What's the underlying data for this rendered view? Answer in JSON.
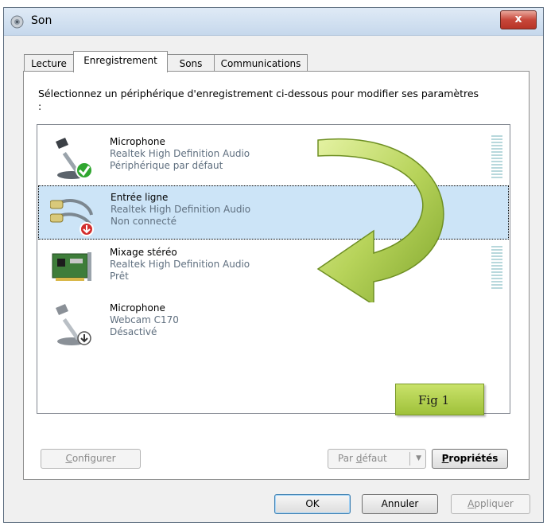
{
  "window": {
    "title": "Son",
    "close_label": "x"
  },
  "tabs": [
    {
      "label": "Lecture",
      "active": false
    },
    {
      "label": "Enregistrement",
      "active": true
    },
    {
      "label": "Sons",
      "active": false
    },
    {
      "label": "Communications",
      "active": false
    }
  ],
  "instructions": "Sélectionnez un périphérique d'enregistrement ci-dessous pour modifier ses paramètres :",
  "devices": [
    {
      "name": "Microphone",
      "driver": "Realtek High Definition Audio",
      "status": "Périphérique par défaut",
      "icon": "microphone-icon",
      "badge": "default-check-icon",
      "selected": false,
      "has_level_meter": true
    },
    {
      "name": "Entrée ligne",
      "driver": "Realtek High Definition Audio",
      "status": "Non connecté",
      "icon": "line-in-cable-icon",
      "badge": "not-connected-icon",
      "selected": true,
      "has_level_meter": false
    },
    {
      "name": "Mixage stéréo",
      "driver": "Realtek High Definition Audio",
      "status": "Prêt",
      "icon": "sound-card-icon",
      "badge": "",
      "selected": false,
      "has_level_meter": true
    },
    {
      "name": "Microphone",
      "driver": "Webcam C170",
      "status": "Désactivé",
      "icon": "microphone-icon",
      "badge": "disabled-icon",
      "selected": false,
      "has_level_meter": false
    }
  ],
  "buttons": {
    "configure": {
      "mnemonic": "C",
      "rest": "onfigurer"
    },
    "set_default": {
      "before": "Par ",
      "mnemonic": "d",
      "after": "éfaut"
    },
    "properties": {
      "mnemonic": "P",
      "rest": "ropriétés"
    },
    "ok": "OK",
    "cancel": "Annuler",
    "apply": {
      "mnemonic": "A",
      "rest": "ppliquer"
    }
  },
  "annotation": {
    "label": "Fig 1"
  },
  "colors": {
    "selection": "#cce4f7",
    "close_button": "#c7473a",
    "annotation_green": "#9fc13a",
    "level_meter": "#b8d8dc"
  }
}
